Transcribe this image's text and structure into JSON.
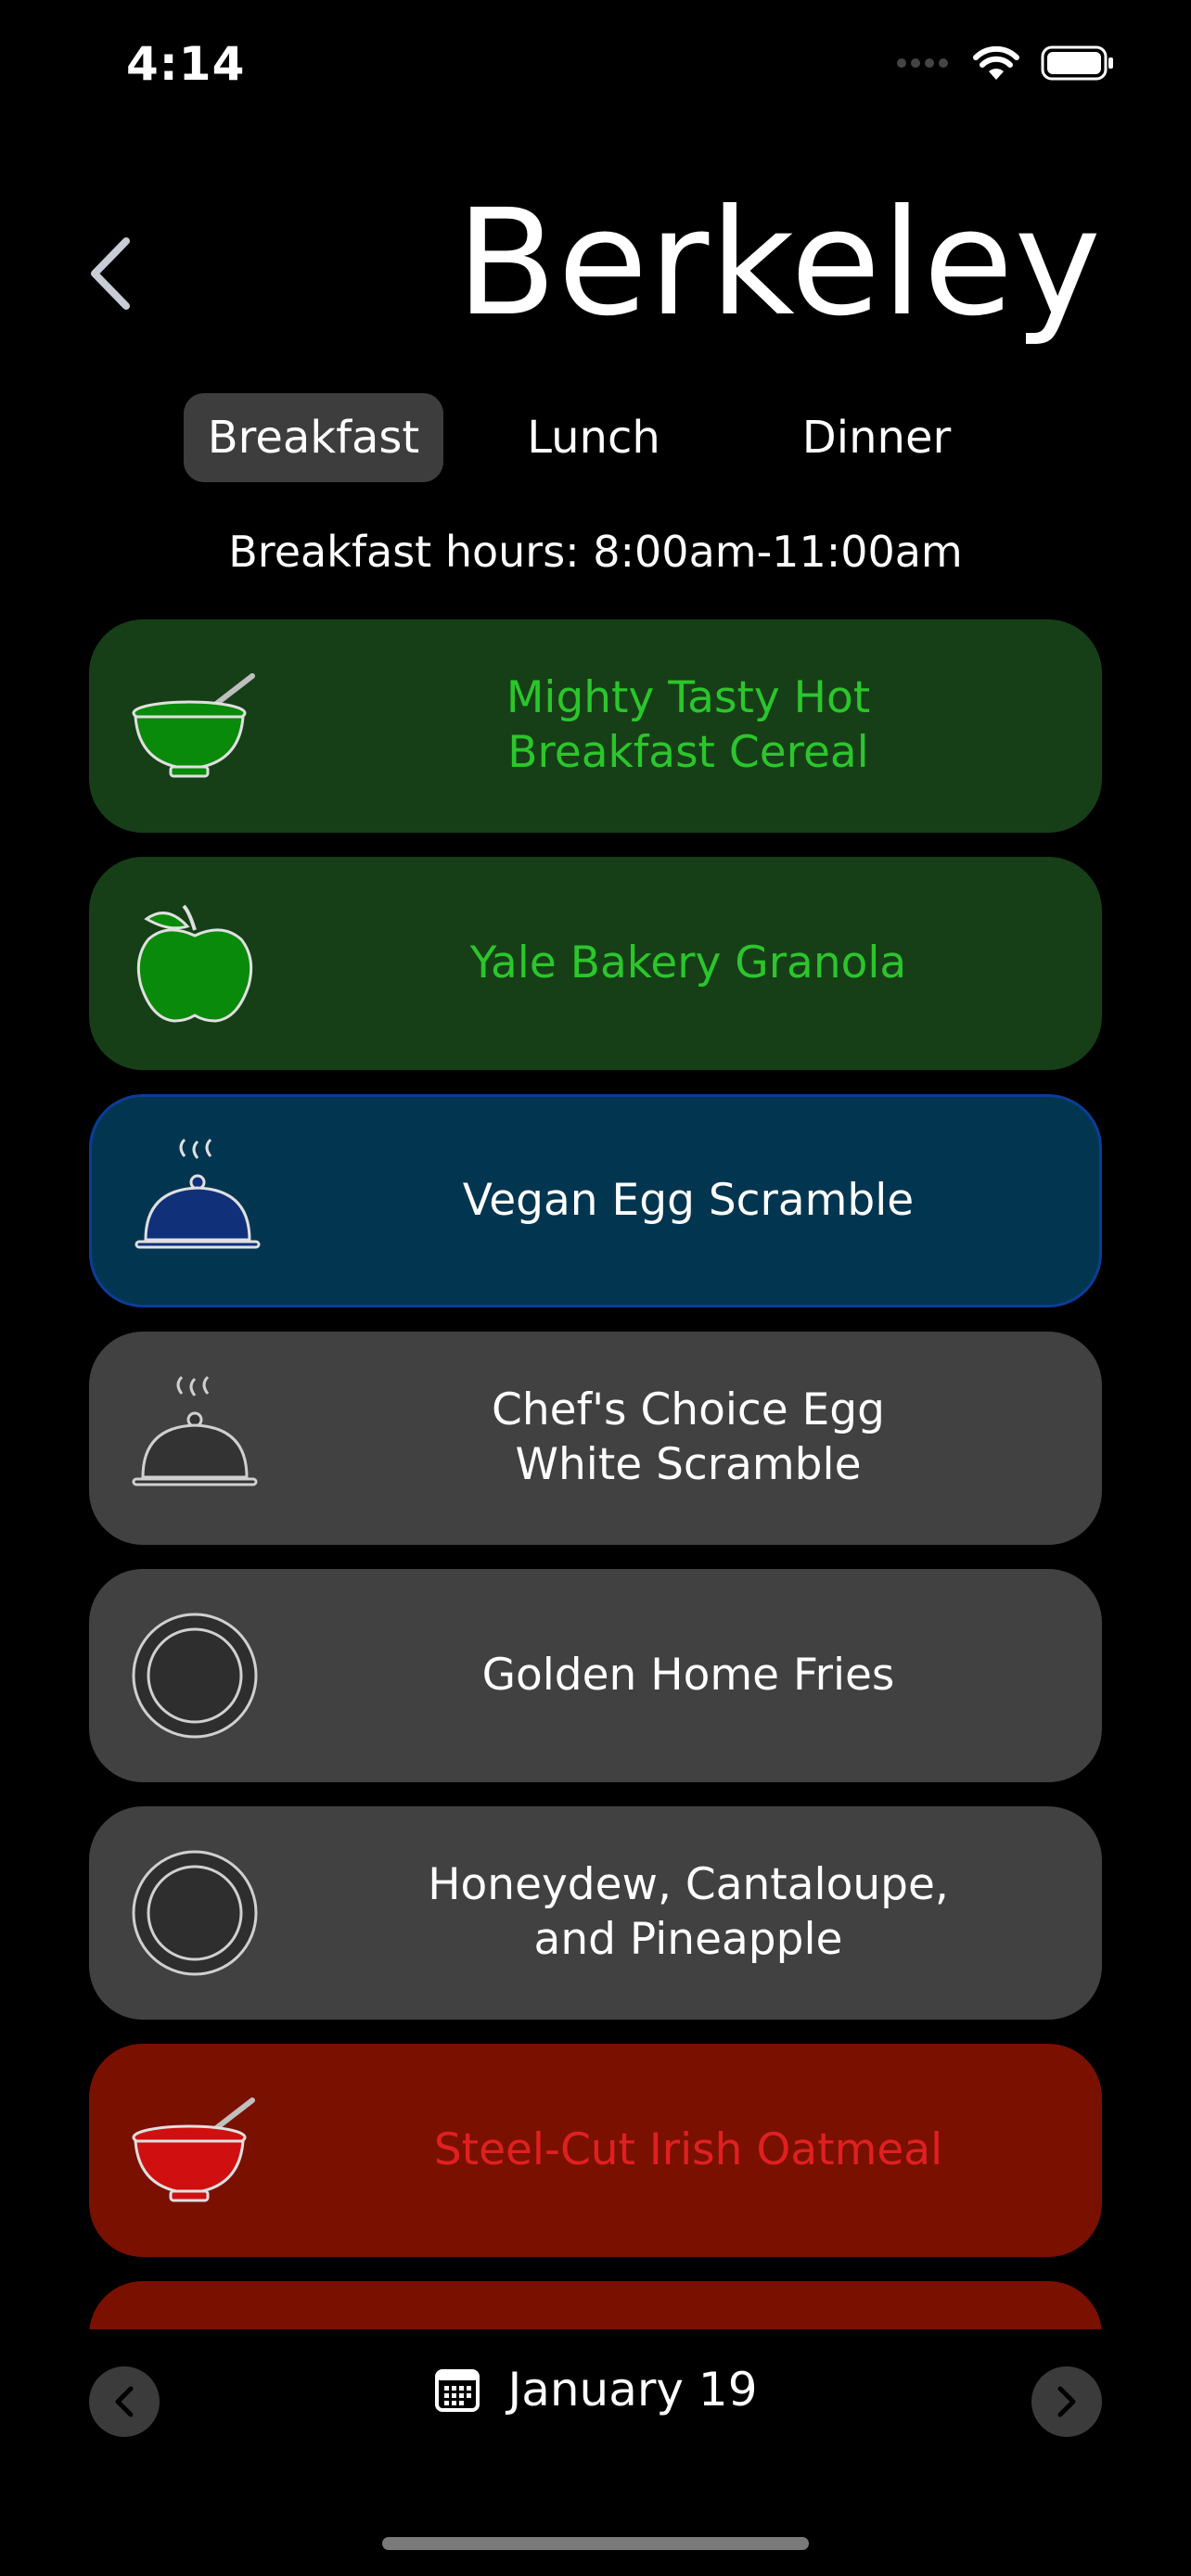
{
  "status": {
    "time": "4:14"
  },
  "header": {
    "title": "Berkeley"
  },
  "tabs": [
    {
      "label": "Breakfast",
      "active": true
    },
    {
      "label": "Lunch",
      "active": false
    },
    {
      "label": "Dinner",
      "active": false
    }
  ],
  "hours": "Breakfast hours: 8:00am-11:00am",
  "menu_items": [
    {
      "label": "Mighty Tasty Hot\nBreakfast Cereal",
      "color": "green",
      "icon": "bowl-icon"
    },
    {
      "label": "Yale Bakery Granola",
      "color": "green",
      "icon": "apple-icon"
    },
    {
      "label": "Vegan Egg Scramble",
      "color": "blue",
      "icon": "cloche-icon"
    },
    {
      "label": "Chef's Choice Egg\nWhite Scramble",
      "color": "gray",
      "icon": "cloche-icon"
    },
    {
      "label": "Golden Home Fries",
      "color": "gray",
      "icon": "plate-icon"
    },
    {
      "label": "Honeydew, Cantaloupe,\nand Pineapple",
      "color": "gray",
      "icon": "plate-icon"
    },
    {
      "label": "Steel-Cut Irish Oatmeal",
      "color": "red",
      "icon": "bowl-icon"
    },
    {
      "label": "",
      "color": "red",
      "icon": "bowl-icon"
    }
  ],
  "footer": {
    "date": "January 19"
  },
  "colors": {
    "green_text": "#2bc62b",
    "green_bg": "#163f18",
    "blue_bg": "#023650",
    "gray_bg": "#414141",
    "red_bg": "#7a1000",
    "red_text": "#e02020"
  }
}
